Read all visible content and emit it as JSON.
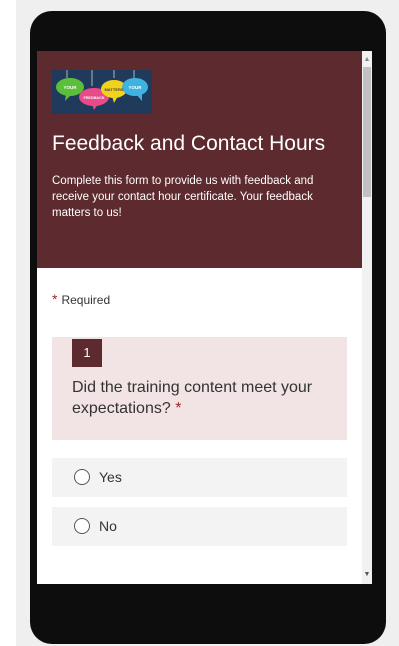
{
  "form": {
    "logo_words": [
      "YOUR",
      "FEEDBACK",
      "MATTERS",
      "YOUR"
    ],
    "title": "Feedback and Contact Hours",
    "description": "Complete this form to provide us with feedback and receive your contact hour certificate.  Your feedback matters to us!",
    "required_star": "*",
    "required_label": "Required"
  },
  "question": {
    "number": "1",
    "text": "Did the training content meet your expectations?",
    "required_star": "*",
    "options": [
      {
        "label": "Yes",
        "selected": false
      },
      {
        "label": "No",
        "selected": false
      }
    ]
  },
  "colors": {
    "header": "#5c2a2f",
    "question_bg": "#f2e3e4",
    "required": "#a4262c"
  },
  "icons": {
    "scroll_up": "scroll-up-arrow-icon",
    "scroll_down": "scroll-down-arrow-icon"
  }
}
